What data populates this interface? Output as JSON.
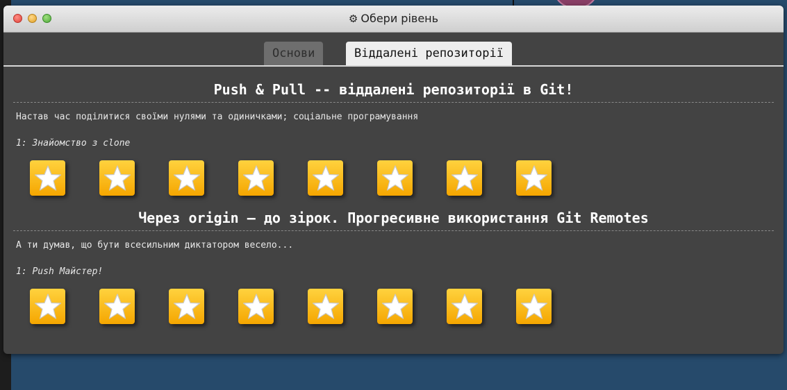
{
  "window": {
    "title": "Обери рівень",
    "title_icon": "gear-icon"
  },
  "tabs": [
    {
      "label": "Основи",
      "active": false
    },
    {
      "label": "Віддалені репозиторії",
      "active": true
    }
  ],
  "sections": [
    {
      "title": "Push & Pull -- віддалені репозиторії в Git!",
      "description": "Настав час поділитися своїми нулями та одиничками; соціальне програмування",
      "level": "1: Знайомство з clone",
      "stars": 8
    },
    {
      "title": "Через origin – до зірок. Прогресивне використання Git Remotes",
      "description": "А ти думав, що бути всесильним диктатором весело...",
      "level": "1: Push Майстер!",
      "stars": 8
    }
  ],
  "colors": {
    "window_bg": "#434343",
    "star_bg_top": "#ffd23e",
    "star_bg_bottom": "#f5a600",
    "desktop_bg": "#264a6b"
  }
}
